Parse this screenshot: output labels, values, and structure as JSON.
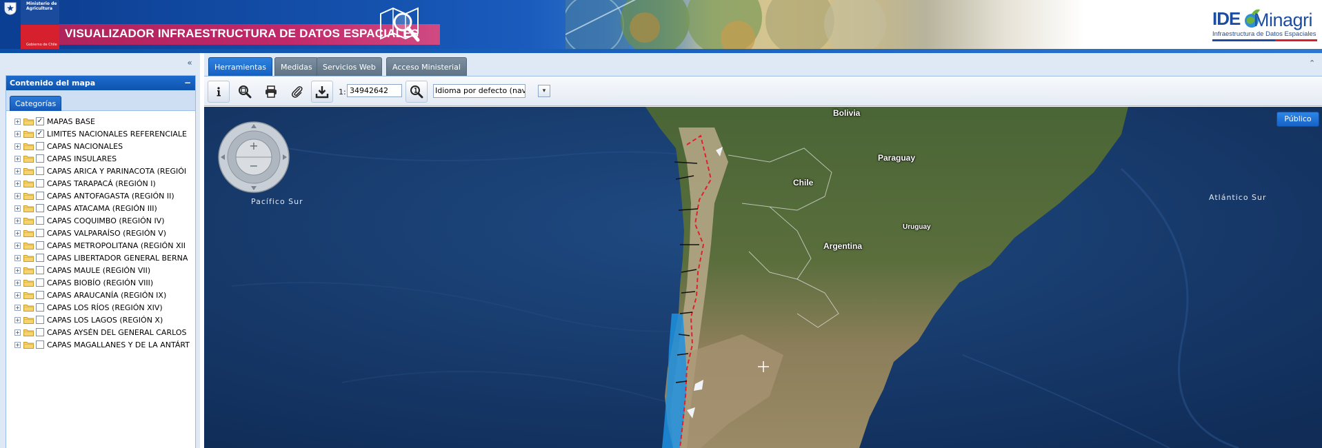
{
  "header": {
    "ministry_line1": "Ministerio de",
    "ministry_line2": "Agricultura",
    "gov_label": "Gobierno de Chile",
    "app_title": "VISUALIZADOR INFRAESTRUCTURA DE DATOS ESPACIALES",
    "logo_ide": "IDE",
    "logo_minagri": "Minagri",
    "logo_subtitle": "Infraestructura de Datos Espaciales"
  },
  "left_panel": {
    "title": "Contenido del mapa",
    "minimize_symbol": "−",
    "collapse_symbol": "«",
    "tab_label": "Categorías",
    "layers": [
      {
        "label": "MAPAS BASE",
        "checked": true
      },
      {
        "label": "LIMITES NACIONALES REFERENCIALE",
        "checked": true
      },
      {
        "label": "CAPAS NACIONALES",
        "checked": false
      },
      {
        "label": "CAPAS INSULARES",
        "checked": false
      },
      {
        "label": "CAPAS ARICA Y PARINACOTA (REGIÓI",
        "checked": false
      },
      {
        "label": "CAPAS TARAPACÁ (REGIÓN I)",
        "checked": false
      },
      {
        "label": "CAPAS ANTOFAGASTA (REGIÓN II)",
        "checked": false
      },
      {
        "label": "CAPAS ATACAMA (REGIÓN III)",
        "checked": false
      },
      {
        "label": "CAPAS COQUIMBO (REGIÓN IV)",
        "checked": false
      },
      {
        "label": "CAPAS VALPARAÍSO (REGIÓN V)",
        "checked": false
      },
      {
        "label": "CAPAS METROPOLITANA (REGIÓN XII",
        "checked": false
      },
      {
        "label": "CAPAS LIBERTADOR GENERAL BERNA",
        "checked": false
      },
      {
        "label": "CAPAS MAULE (REGIÓN VII)",
        "checked": false
      },
      {
        "label": "CAPAS BIOBÍO (REGIÓN VIII)",
        "checked": false
      },
      {
        "label": "CAPAS ARAUCANÍA (REGIÓN IX)",
        "checked": false
      },
      {
        "label": "CAPAS LOS RÍOS (REGIÓN XIV)",
        "checked": false
      },
      {
        "label": "CAPAS LOS LAGOS (REGIÓN X)",
        "checked": false
      },
      {
        "label": "CAPAS AYSÉN DEL GENERAL CARLOS",
        "checked": false
      },
      {
        "label": "CAPAS MAGALLANES Y DE LA ANTÁRT",
        "checked": false
      }
    ]
  },
  "top_tabs": {
    "tabs": [
      "Herramientas",
      "Medidas",
      "Servicios Web",
      "Acceso Ministerial"
    ],
    "active_index": 0,
    "collapse_symbol": "⌃"
  },
  "toolbar": {
    "scale_prefix": "1:",
    "scale_value": "34942642",
    "language_value": "Idioma por defecto (navegador)",
    "language_arrow": "▾",
    "icons": [
      "info-icon",
      "zoom-extent-icon",
      "print-icon",
      "attach-icon",
      "download-icon",
      "scale-zoom-icon"
    ]
  },
  "map": {
    "publico_label": "Público",
    "labels": {
      "pacifico": "Pacífico Sur",
      "atlantico": "Atlántico Sur",
      "bolivia": "Bolivia",
      "paraguay": "Paraguay",
      "chile": "Chile",
      "uruguay": "Uruguay",
      "argentina": "Argentina"
    },
    "zoom_in": "+",
    "zoom_out": "−"
  },
  "colors": {
    "header_blue": "#0b3f93",
    "title_band": "#c0286a",
    "panel_header": "#1563c4",
    "ocean": "#17396a",
    "border_red": "#e0202a"
  }
}
